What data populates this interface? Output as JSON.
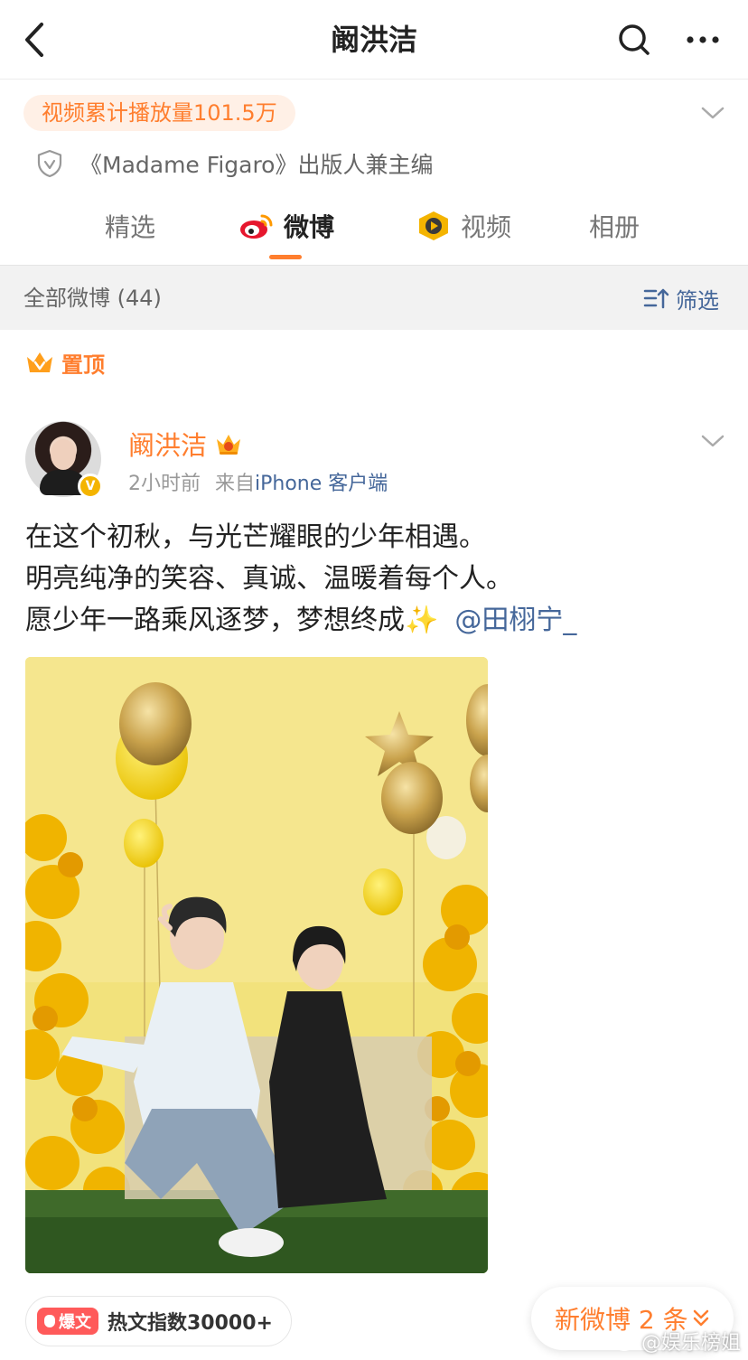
{
  "nav": {
    "title": "阚洪洁",
    "back_icon": "chevron-left-icon",
    "search_icon": "search-icon",
    "more_icon": "more-horizontal-icon"
  },
  "profile": {
    "views_badge": "视频累计播放量101.5万",
    "verify_text": "《Madame Figaro》出版人兼主编",
    "verify_icon": "shield-check-icon"
  },
  "tabs": [
    {
      "label": "精选",
      "active": false
    },
    {
      "label": "微博",
      "active": true,
      "icon": "weibo-logo-icon"
    },
    {
      "label": "视频",
      "active": false,
      "icon": "video-play-icon"
    },
    {
      "label": "相册",
      "active": false
    }
  ],
  "filter_bar": {
    "count_label": "全部微博 (44)",
    "filter_label": "筛选"
  },
  "pinned": {
    "label": "置顶"
  },
  "post": {
    "username": "阚洪洁",
    "time": "2小时前",
    "source_prefix": "来自",
    "source_client": "iPhone 客户端",
    "lines": [
      "在这个初秋，与光芒耀眼的少年相遇。",
      "明亮纯净的笑容、真诚、温暖着每个人。",
      "愿少年一路乘风逐梦，梦想终成"
    ],
    "sparkle": "✨",
    "mention": "@田栩宁_",
    "hot_tag": "爆文",
    "hot_text": "热文指数30000+"
  },
  "new_posts": {
    "label": "新微博 2 条"
  },
  "watermark": "@娱乐榜姐",
  "colors": {
    "accent": "#ff7e2e",
    "link": "#45679a",
    "hot": "#ff5a5a"
  }
}
